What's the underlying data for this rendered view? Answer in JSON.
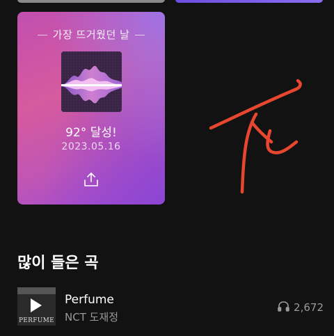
{
  "hot_day_card": {
    "title": "가장 뜨거웠던 날",
    "temperature": "92° 달성!",
    "date": "2023.05.16",
    "icon_share": "share-icon"
  },
  "most_played": {
    "section_title": "많이 들은 곡",
    "songs": [
      {
        "title": "Perfume",
        "artist": "NCT 도재정",
        "play_count": "2,672",
        "album_logo_text": "PERFUME"
      }
    ]
  },
  "colors": {
    "background": "#121212",
    "card_pink": "#d65a9e",
    "card_purple": "#9b48d6",
    "signature_red": "#e8472f"
  }
}
